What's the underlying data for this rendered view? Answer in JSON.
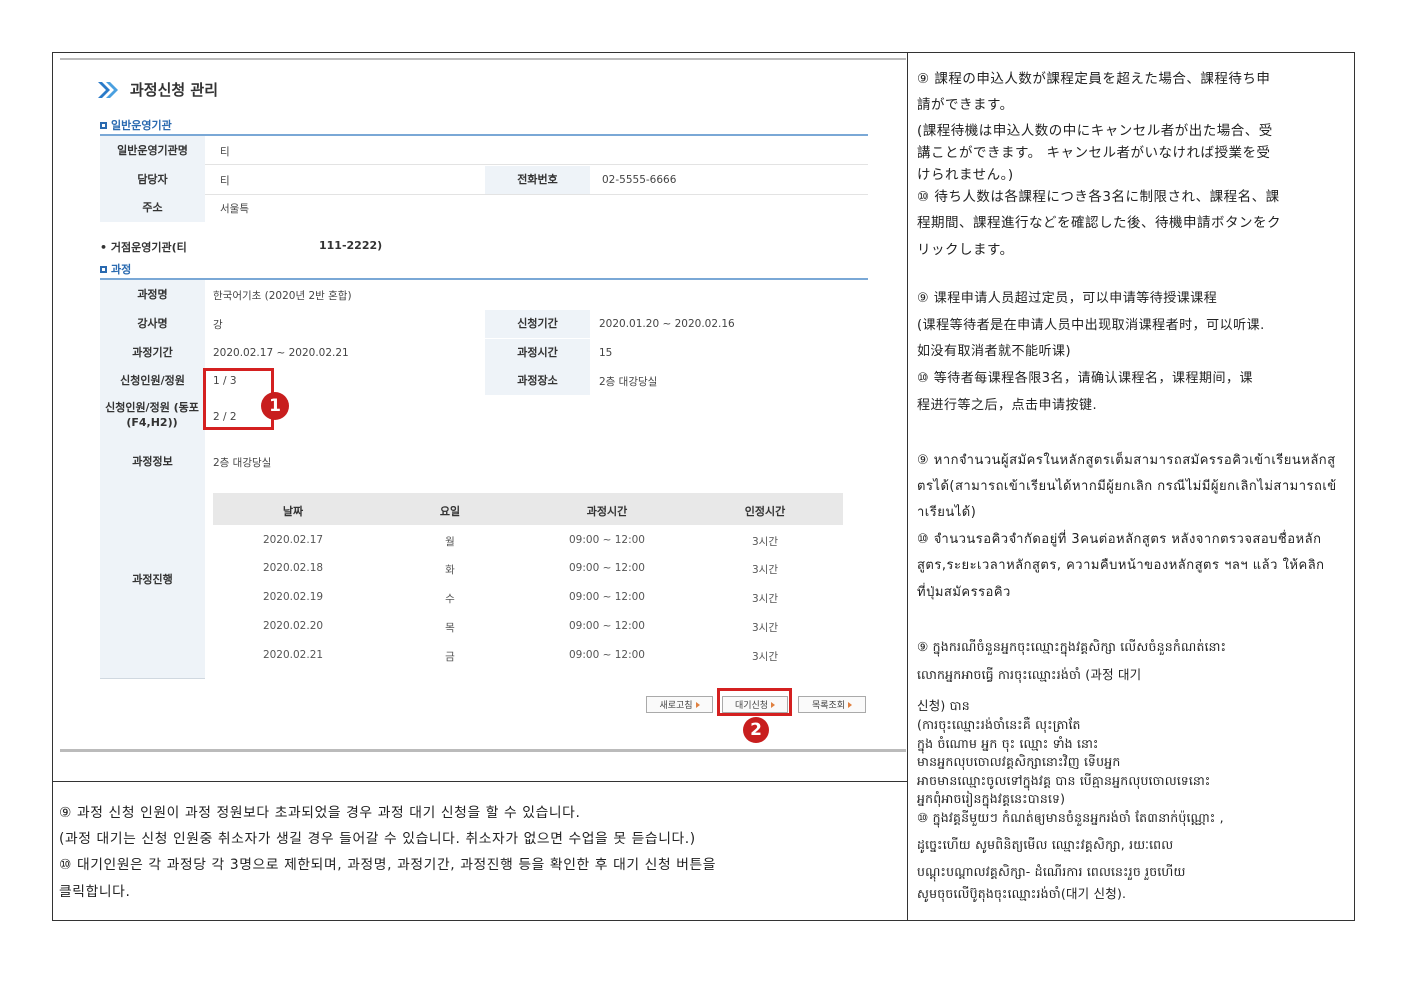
{
  "screenshot": {
    "page_title": "과정신청 관리",
    "section_org": "일반운영기관",
    "org_rows": [
      {
        "label": "일반운영기관명",
        "value": "티"
      },
      {
        "label": "담당자",
        "value": "티",
        "label2": "전화번호",
        "value2": "02-5555-6666"
      },
      {
        "label": "주소",
        "value": "서울특"
      }
    ],
    "base_org_line": "• 거점운영기관(티",
    "base_org_phone": "111-2222)",
    "section_course": "과정",
    "course": {
      "name_label": "과정명",
      "name_value": "한국어기초 (2020년 2반 혼합)",
      "teacher_label": "강사명",
      "teacher_value": "강",
      "apply_period_label": "신청기간",
      "apply_period_value": "2020.01.20 ~ 2020.02.16",
      "course_period_label": "과정기간",
      "course_period_value": "2020.02.17 ~ 2020.02.21",
      "course_hours_label": "과정시간",
      "course_hours_value": "15",
      "applicants_label": "신청인원/정원",
      "applicants_value": "1 / 3",
      "place_label": "과정장소",
      "place_value": "2층 대강당실",
      "applicants_f4_label": "신청인원/정원 (동포(F4,H2))",
      "applicants_f4_value": "2 / 2",
      "info_label": "과정정보",
      "info_value": "2층 대강당실",
      "progress_label": "과정진행"
    },
    "schedule_headers": [
      "날짜",
      "요일",
      "과정시간",
      "인정시간"
    ],
    "schedule_rows": [
      [
        "2020.02.17",
        "월",
        "09:00 ~ 12:00",
        "3시간"
      ],
      [
        "2020.02.18",
        "화",
        "09:00 ~ 12:00",
        "3시간"
      ],
      [
        "2020.02.19",
        "수",
        "09:00 ~ 12:00",
        "3시간"
      ],
      [
        "2020.02.20",
        "목",
        "09:00 ~ 12:00",
        "3시간"
      ],
      [
        "2020.02.21",
        "금",
        "09:00 ~ 12:00",
        "3시간"
      ]
    ],
    "buttons": {
      "refresh": "새로고침",
      "waitlist": "대기신청",
      "list": "목록조회"
    },
    "badge1": "1",
    "badge2": "2"
  },
  "korean_text": {
    "line1": "⑨  과정 신청 인원이 과정 정원보다 초과되었을 경우 과정 대기 신청을 할 수 있습니다.",
    "line2": "(과정 대기는 신청 인원중 취소자가 생길 경우 들어갈 수 있습니다. 취소자가 없으면 수업을 못 듣습니다.)",
    "line3": "⑩ 대기인원은 각 과정당 각 3명으로 제한되며, 과정명, 과정기간, 과정진행 등을 확인한 후 대기 신청 버튼을",
    "line4": "클릭합니다."
  },
  "japanese_text": {
    "l1": "⑨  課程の申込人数が課程定員を超えた場合、課程待ち申",
    "l2": "請ができます。",
    "l3": "(課程待機は申込人数の中にキャンセル者が出た場合、受",
    "l4": "講ことができます。   キャンセル者がいなければ授業を受",
    "l5": "けられません。)",
    "l6": "⑩ 待ち人数は各課程につき各3名に制限され、課程名、課",
    "l7": "程期間、課程進行などを確認した後、待機申請ボタンをク",
    "l8": "リックします。"
  },
  "chinese_text": {
    "l1": "⑨ 课程申请人员超过定员，可以申请等待授课课程",
    "l2": "(课程等待者是在申请人员中出现取消课程者时，可以听课.",
    "l3": "如没有取消者就不能听课)",
    "l4": "⑩   等待者每课程各限3名，请确认课程名，课程期间，课",
    "l5": "程进行等之后，点击申请按键."
  },
  "thai_text": {
    "l1": "⑨ หากจำนวนผู้สมัครในหลักสูตรเต็มสามารถสมัครรอคิวเข้าเรียนหลักสู",
    "l2": "ตรได้(สามารถเข้าเรียนได้หากมีผู้ยกเลิก กรณีไม่มีผู้ยกเลิกไม่สามารถเข้",
    "l3": "าเรียนได้)",
    "l4": "⑩ จำนวนรอคิวจำกัดอยู่ที่ 3คนต่อหลักสูตร หลังจากตรวจสอบชื่อหลัก",
    "l5": "สูตร,ระยะเวลาหลักสูตร, ความคืบหน้าของหลักสูตร ฯลฯ แล้ว ให้คลิก",
    "l6": "ที่ปุ่มสมัครรอคิว"
  },
  "khmer_text": {
    "l1": "⑨  ក្នុងករណីចំនួនអ្នកចុះឈ្មោះក្នុងវគ្គសិក្សា លើសចំនួនកំណត់នោះ",
    "l2": "លោកអ្នកអាចធ្វើ ការចុះឈ្មោះរង់ចាំ (과정 대기",
    "l3": "신청) បាន",
    "l4": "(ការចុះឈ្មោះរង់ចាំនេះគឺ                                    លុះត្រាតែ",
    "l5": "ក្នុង ចំណោម អ្នក ចុះ ឈ្មោះ ទាំង នោះ",
    "l6": "មានអ្នកលុបចោលវគ្គសិក្សានោះវិញ ទើបអ្នក",
    "l7": "អាចមានឈ្មោះចូលទៅក្នុងវគ្គ បាន  បើគ្មានអ្នកលុបចោលទេនោះ",
    "l8": "អ្នកពុំអាចរៀនក្នុងវគ្គនេះបានទេ)",
    "l9": "⑩  ក្នុងវគ្គនីមួយៗ កំណត់ឲ្យមានចំនួនអ្នករង់ចាំ តែ៣នាក់ប៉ុណ្ណោះ ,",
    "l10": "ដូច្នេះហើយ សូមពិនិត្យមើល ឈ្មោះវគ្គសិក្សា, រយៈពេល",
    "l11": "បណ្តុះបណ្តាលវគ្គសិក្សា- ដំណើរការ ពេលនេះរួច រួចហើយ",
    "l12": "សូមចុចលើប៊ូតុងចុះឈ្មោះរង់ចាំ(대기 신청)."
  },
  "colors": {
    "accent_blue": "#2a6ab0",
    "highlight_red": "#d42020"
  }
}
